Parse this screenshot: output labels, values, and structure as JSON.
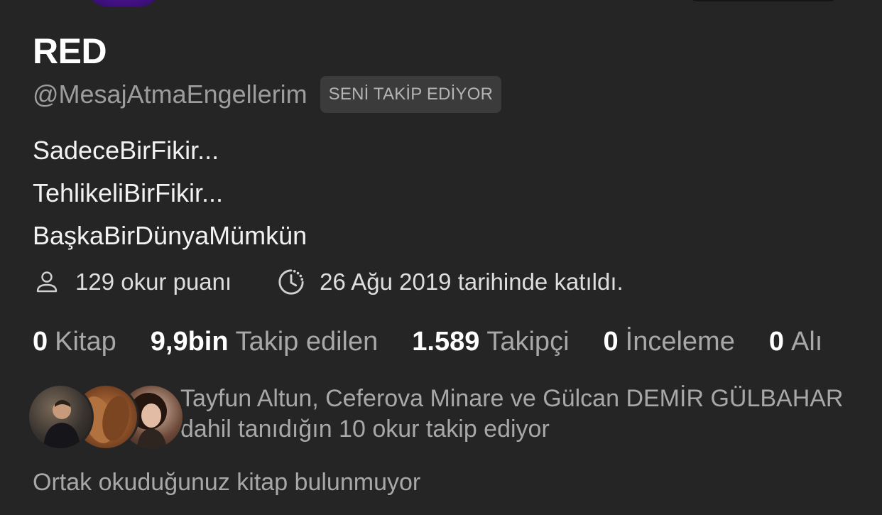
{
  "profile": {
    "name": "RED",
    "handle": "@MesajAtmaEngellerim",
    "follows_you_badge": "SENİ TAKİP EDİYOR",
    "bio_lines": [
      "SadeceBirFikir...",
      "TehlikeliBirFikir...",
      "BaşkaBirDünyaMümkün"
    ]
  },
  "meta": {
    "reader_points": "129 okur puanı",
    "joined": "26 Ağu 2019 tarihinde katıldı.",
    "reader_points_icon": "person-icon",
    "joined_icon": "clock-history-icon"
  },
  "stats": [
    {
      "value": "0",
      "label": "Kitap"
    },
    {
      "value": "9,9bin",
      "label": "Takip edilen"
    },
    {
      "value": "1.589",
      "label": "Takipçi"
    },
    {
      "value": "0",
      "label": "İnceleme"
    },
    {
      "value": "0",
      "label": "Alı"
    }
  ],
  "mutual_followers": {
    "text": "Tayfun Altun, Ceferova Minare ve Gülcan DEMİR GÜLBAHAR dahil tanıdığın 10 okur takip ediyor"
  },
  "common_books": {
    "text": "Ortak okuduğunuz kitap bulunmuyor"
  },
  "colors": {
    "background": "#252525",
    "primary_text": "#ffffff",
    "secondary_text": "#a8a8a8",
    "badge_background": "#3b3b3b"
  }
}
